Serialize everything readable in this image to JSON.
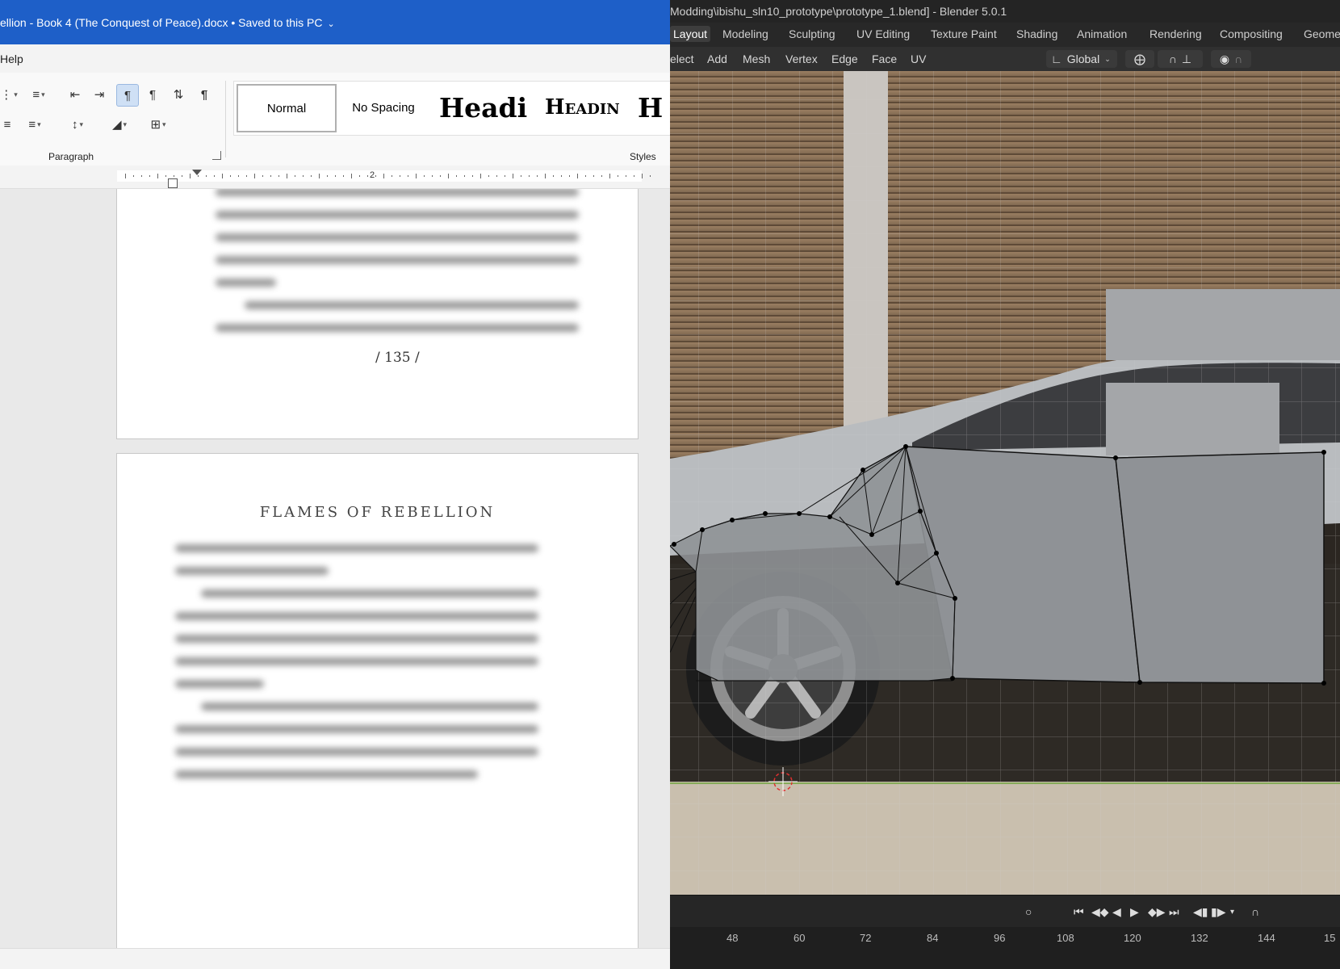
{
  "word": {
    "title": "ellion - Book 4 (The Conquest of Peace).docx  •  Saved to this PC",
    "menu_help": "Help",
    "paragraph_group_label": "Paragraph",
    "styles_group_label": "Styles",
    "styles": [
      "Normal",
      "No Spacing",
      "Headi",
      "Headin",
      "H"
    ],
    "ruler_number": "2",
    "page_number": "/ 135 /",
    "chapter_heading": "FLAMES OF REBELLION"
  },
  "blender": {
    "title": "Modding\\ibishu_sln10_prototype\\prototype_1.blend] - Blender 5.0.1",
    "workspaces": [
      "Layout",
      "Modeling",
      "Sculpting",
      "UV Editing",
      "Texture Paint",
      "Shading",
      "Animation",
      "Rendering",
      "Compositing",
      "Geome"
    ],
    "active_workspace": "Layout",
    "header_menus": [
      "elect",
      "Add",
      "Mesh",
      "Vertex",
      "Edge",
      "Face",
      "UV"
    ],
    "transform_orientation": "Global",
    "timeline_frames": [
      "48",
      "60",
      "72",
      "84",
      "96",
      "108",
      "120",
      "132",
      "144",
      "15"
    ]
  },
  "colors": {
    "word_accent": "#1e5fc8",
    "blender_bg": "#1d1d1d",
    "mesh_face": "#8f9296"
  }
}
